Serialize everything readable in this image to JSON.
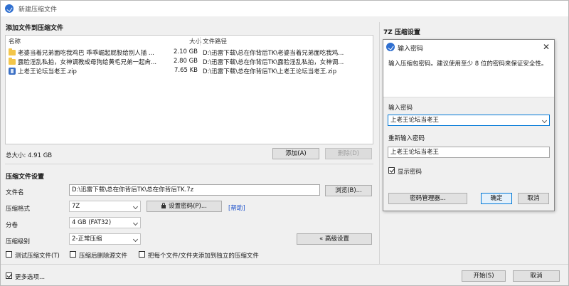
{
  "window": {
    "title": "新建压缩文件"
  },
  "add_section": {
    "title": "添加文件到压缩文件",
    "columns": {
      "name": "名称",
      "size": "大小",
      "path": "文件路径"
    },
    "files": [
      {
        "icon": "folder-icon",
        "name": "老婆当着兄弟面吃我鸡巴 乖乖崛起屁股给别人插 ...",
        "size": "2.10 GB",
        "path": "D:\\迅雷下载\\总在你背后TK\\老婆当着兄弟面吃我鸡..."
      },
      {
        "icon": "folder-icon",
        "name": "露脸淫乱私拍，女神调教成母狗给黄毛兄弟一起肏...",
        "size": "2.80 GB",
        "path": "D:\\迅雷下载\\总在你背后TK\\露脸淫乱私拍，女神调..."
      },
      {
        "icon": "zip-file-icon",
        "name": "上老王论坛当老王.zip",
        "size": "7.65 KB",
        "path": "D:\\迅雷下载\\总在你背后TK\\上老王论坛当老王.zip"
      }
    ],
    "total_label": "总大小: 4.91 GB",
    "add_button": "添加(A)",
    "delete_button": "删除(D)"
  },
  "settings_section": {
    "title": "压缩文件设置",
    "filename_label": "文件名",
    "filename_value": "D:\\迅雷下载\\总在你背后TK\\总在你背后TK.7z",
    "browse_button": "浏览(B)...",
    "format_label": "压缩格式",
    "format_value": "7Z",
    "set_password_button": "设置密码(P)...",
    "help_link": "[帮助]",
    "split_label": "分卷",
    "split_value": "4 GB (FAT32)",
    "level_label": "压缩级别",
    "level_value": "2-正常压缩",
    "advanced_button": "« 高级设置",
    "options": [
      {
        "label": "测试压缩文件(T)",
        "checked": false
      },
      {
        "label": "压缩后删除源文件",
        "checked": false
      },
      {
        "label": "把每个文件/文件夹添加到独立的压缩文件",
        "checked": false
      }
    ]
  },
  "right_panel": {
    "title": "7Z 压缩设置"
  },
  "password_dialog": {
    "title": "输入密码",
    "description": "输入压缩包密码。建议使用至少 8 位的密码来保证安全性。",
    "enter_label": "输入密码",
    "enter_value": "上老王论坛当老王",
    "reenter_label": "重新输入密码",
    "reenter_value": "上老王论坛当老王",
    "show_password_label": "显示密码",
    "show_password_checked": true,
    "manager_button": "密码管理器...",
    "ok_button": "确定",
    "cancel_button": "取消"
  },
  "bottom": {
    "more_options_label": "更多选项...",
    "more_options_checked": true,
    "start_button": "开始(S)",
    "cancel_button": "取消"
  }
}
